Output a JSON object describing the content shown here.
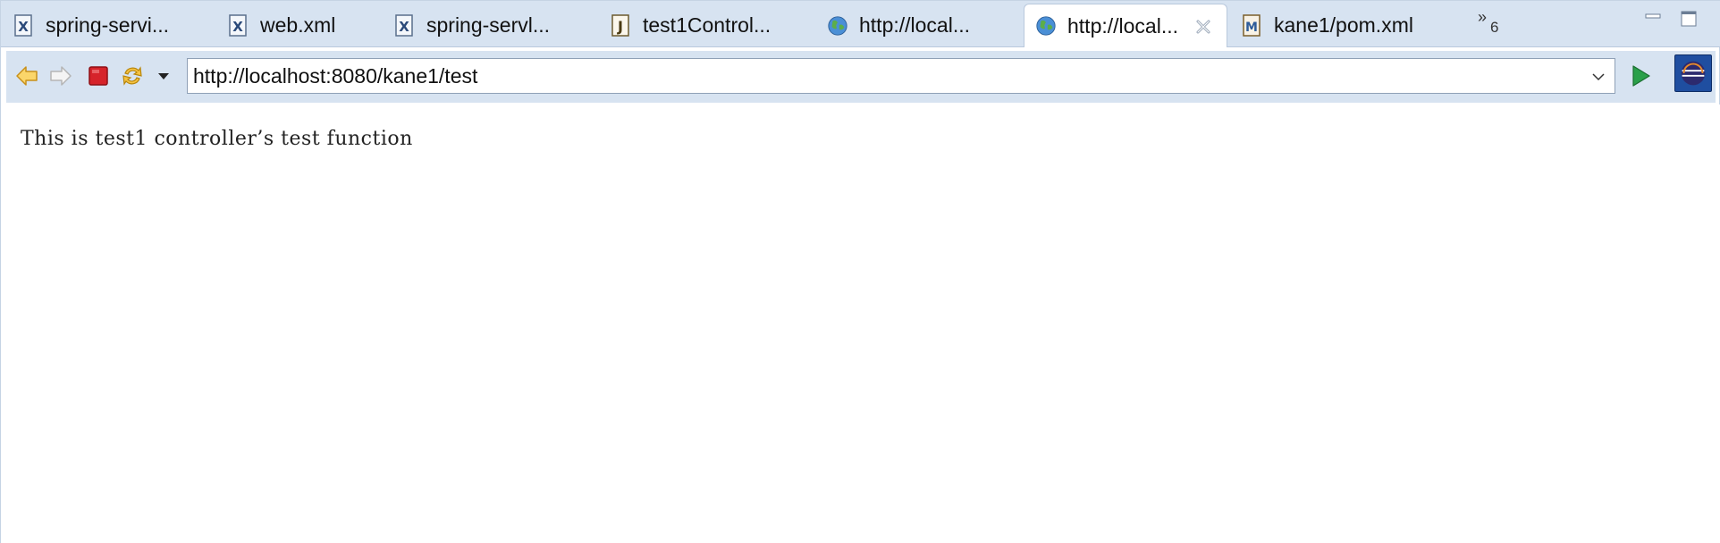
{
  "tabs": [
    {
      "label": "spring-servi...",
      "icon": "xml-file-icon"
    },
    {
      "label": "web.xml",
      "icon": "xml-file-icon"
    },
    {
      "label": "spring-servl...",
      "icon": "xml-file-icon"
    },
    {
      "label": "test1Control...",
      "icon": "java-file-icon"
    },
    {
      "label": "http://local...",
      "icon": "globe-icon"
    },
    {
      "label": "http://local...",
      "icon": "globe-icon",
      "active": true
    },
    {
      "label": "kane1/pom.xml",
      "icon": "maven-file-icon"
    }
  ],
  "overflow": {
    "count": "6",
    "icon": "chevron-double-right-icon"
  },
  "toolbar": {
    "url": "http://localhost:8080/kane1/test",
    "buttons": [
      "back-icon",
      "forward-icon",
      "stop-icon",
      "refresh-icon",
      "menu-arrow-icon",
      "go-icon",
      "eclipse-icon"
    ]
  },
  "page": {
    "text": "This is test1 controller’s test function"
  },
  "colors": {
    "tab_bar": "#d7e3f1",
    "active_tab": "#ffffff",
    "border": "#b9c9dd",
    "stop_red": "#d6232a",
    "go_green": "#2aa04a"
  }
}
